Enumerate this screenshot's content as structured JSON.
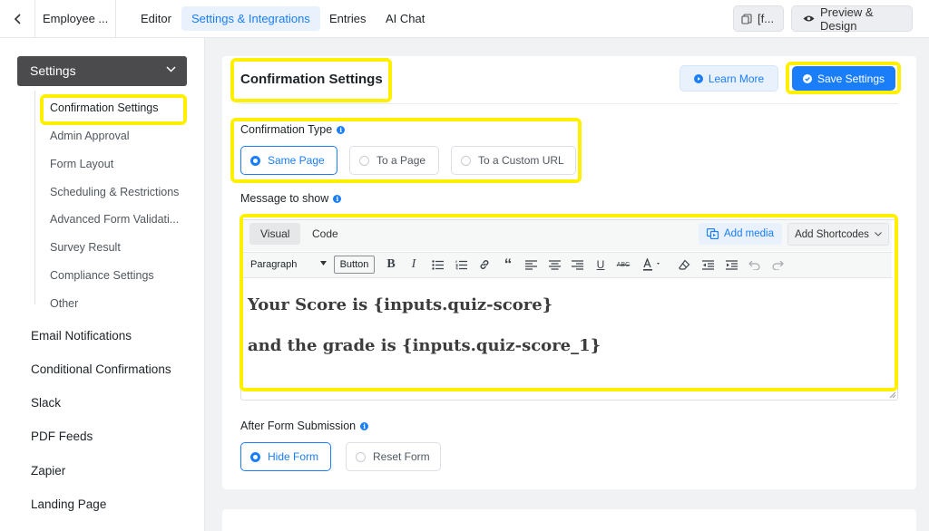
{
  "topbar": {
    "form_name": "Employee ...",
    "tabs": [
      "Editor",
      "Settings & Integrations",
      "Entries",
      "AI Chat"
    ],
    "shortcode_btn": "[f...",
    "preview_btn": "Preview & Design"
  },
  "sidebar": {
    "section_title": "Settings",
    "sub_items": [
      "Confirmation Settings",
      "Admin Approval",
      "Form Layout",
      "Scheduling & Restrictions",
      "Advanced Form Validati...",
      "Survey Result",
      "Compliance Settings",
      "Other"
    ],
    "items": [
      "Email Notifications",
      "Conditional Confirmations",
      "Slack",
      "PDF Feeds",
      "Zapier",
      "Landing Page"
    ]
  },
  "main": {
    "title": "Confirmation Settings",
    "learn_more": "Learn More",
    "save": "Save Settings",
    "confirmation_type_label": "Confirmation Type",
    "confirmation_options": [
      "Same Page",
      "To a Page",
      "To a Custom URL"
    ],
    "selected_confirmation": "Same Page",
    "message_label": "Message to show",
    "editor": {
      "tabs": [
        "Visual",
        "Code"
      ],
      "add_media": "Add media",
      "add_shortcodes": "Add Shortcodes",
      "format": "Paragraph",
      "button_label": "Button",
      "content_lines": [
        "Your Score is {inputs.quiz-score}",
        "and the grade is {inputs.quiz-score_1}"
      ]
    },
    "after_submission_label": "After Form Submission",
    "after_submission_options": [
      "Hide Form",
      "Reset Form"
    ],
    "selected_after_submission": "Hide Form"
  },
  "colors": {
    "accent": "#1a7efb",
    "highlight": "#fff000",
    "sidebar_head": "#4b4b4d"
  }
}
